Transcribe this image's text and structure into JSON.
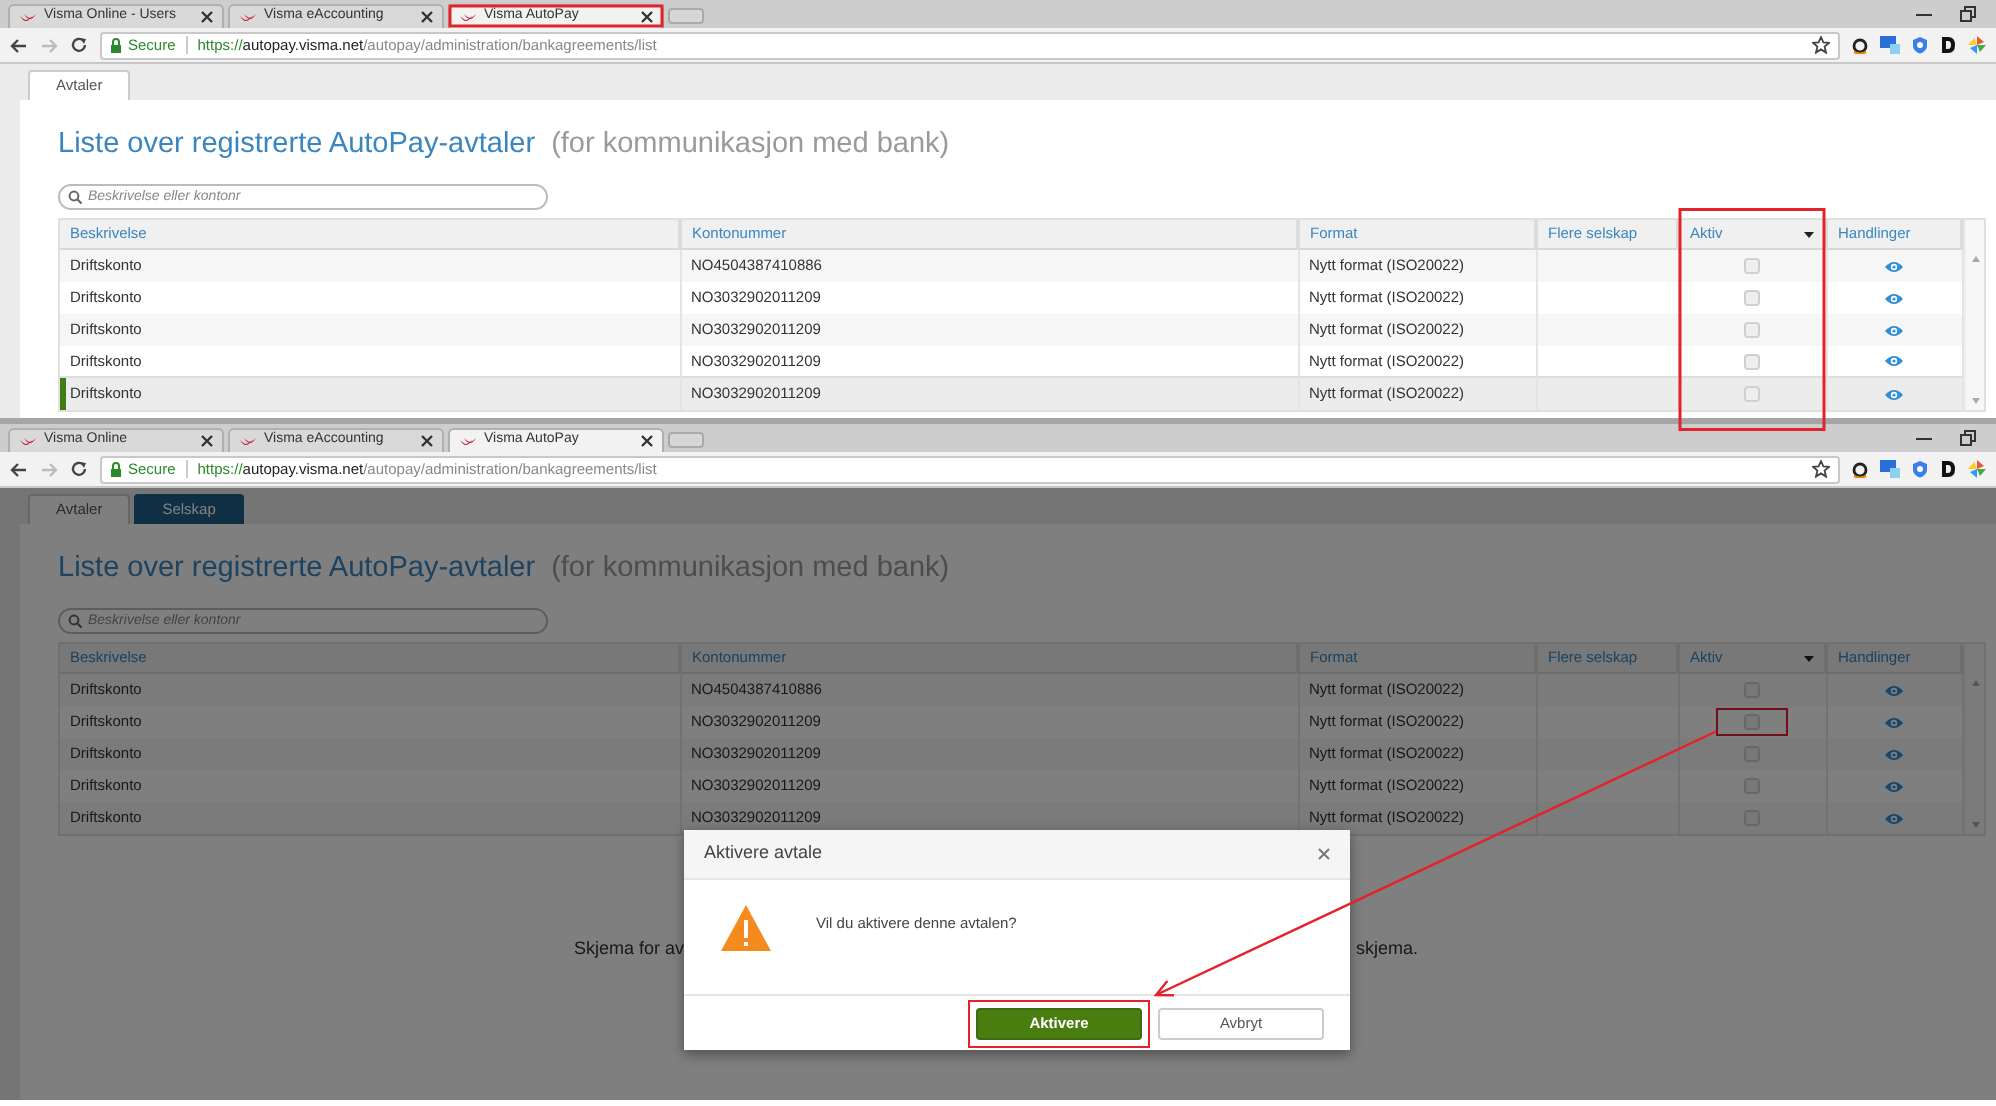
{
  "screens": [
    {
      "browser_tabs": [
        {
          "title": "Visma Online - Users",
          "selected": false,
          "highlighted": false
        },
        {
          "title": "Visma eAccounting",
          "selected": false,
          "highlighted": false
        },
        {
          "title": "Visma AutoPay",
          "selected": true,
          "highlighted": true
        }
      ],
      "address": {
        "secure": "Secure",
        "scheme": "https://",
        "host": "autopay.visma.net",
        "path": "/autopay/administration/bankagreements/list"
      },
      "app_tabs": [
        {
          "label": "Avtaler",
          "selected": true,
          "hovered": false
        }
      ],
      "title": "Liste over registrerte AutoPay-avtaler",
      "subtitle": "(for kommunikasjon med bank)",
      "search": {
        "placeholder": "Beskrivelse eller kontonr"
      },
      "table": {
        "columns": [
          {
            "label": "Beskrivelse",
            "highlighted": false
          },
          {
            "label": "Kontonummer",
            "highlighted": false
          },
          {
            "label": "Format",
            "highlighted": false
          },
          {
            "label": "Flere selskap",
            "highlighted": false
          },
          {
            "label": "Aktiv",
            "highlighted": true
          },
          {
            "label": "Handlinger",
            "highlighted": false
          }
        ],
        "rows": [
          {
            "description": "Driftskonto",
            "account": "NO4504387410886",
            "format": "Nytt format (ISO20022)",
            "active": false,
            "selected": false,
            "checkbox_highlighted": false
          },
          {
            "description": "Driftskonto",
            "account": "NO3032902011209",
            "format": "Nytt format (ISO20022)",
            "active": false,
            "selected": false,
            "checkbox_highlighted": false
          },
          {
            "description": "Driftskonto",
            "account": "NO3032902011209",
            "format": "Nytt format (ISO20022)",
            "active": false,
            "selected": false,
            "checkbox_highlighted": false
          },
          {
            "description": "Driftskonto",
            "account": "NO3032902011209",
            "format": "Nytt format (ISO20022)",
            "active": false,
            "selected": false,
            "checkbox_highlighted": false
          },
          {
            "description": "Driftskonto",
            "account": "NO3032902011209",
            "format": "Nytt format (ISO20022)",
            "active": false,
            "selected": true,
            "checkbox_highlighted": false
          }
        ]
      }
    },
    {
      "browser_tabs": [
        {
          "title": "Visma Online",
          "selected": false,
          "highlighted": false
        },
        {
          "title": "Visma eAccounting",
          "selected": false,
          "highlighted": false
        },
        {
          "title": "Visma AutoPay",
          "selected": true,
          "highlighted": false
        }
      ],
      "address": {
        "secure": "Secure",
        "scheme": "https://",
        "host": "autopay.visma.net",
        "path": "/autopay/administration/bankagreements/list"
      },
      "app_tabs": [
        {
          "label": "Avtaler",
          "selected": true,
          "hovered": false
        },
        {
          "label": "Selskap",
          "selected": false,
          "hovered": true
        }
      ],
      "title": "Liste over registrerte AutoPay-avtaler",
      "subtitle": "(for kommunikasjon med bank)",
      "search": {
        "placeholder": "Beskrivelse eller kontonr"
      },
      "table": {
        "columns": [
          {
            "label": "Beskrivelse",
            "highlighted": false
          },
          {
            "label": "Kontonummer",
            "highlighted": false
          },
          {
            "label": "Format",
            "highlighted": false
          },
          {
            "label": "Flere selskap",
            "highlighted": false
          },
          {
            "label": "Aktiv",
            "highlighted": false
          },
          {
            "label": "Handlinger",
            "highlighted": false
          }
        ],
        "rows": [
          {
            "description": "Driftskonto",
            "account": "NO4504387410886",
            "format": "Nytt format (ISO20022)",
            "active": false,
            "selected": false,
            "checkbox_highlighted": false
          },
          {
            "description": "Driftskonto",
            "account": "NO3032902011209",
            "format": "Nytt format (ISO20022)",
            "active": false,
            "selected": false,
            "checkbox_highlighted": true
          },
          {
            "description": "Driftskonto",
            "account": "NO3032902011209",
            "format": "Nytt format (ISO20022)",
            "active": false,
            "selected": false,
            "checkbox_highlighted": false
          },
          {
            "description": "Driftskonto",
            "account": "NO3032902011209",
            "format": "Nytt format (ISO20022)",
            "active": false,
            "selected": false,
            "checkbox_highlighted": false
          },
          {
            "description": "Driftskonto",
            "account": "NO3032902011209",
            "format": "Nytt format (ISO20022)",
            "active": false,
            "selected": false,
            "checkbox_highlighted": false
          }
        ]
      },
      "background_text_left": "Skjema for av",
      "background_text_right": "skjema.",
      "dialog": {
        "title": "Aktivere avtale",
        "message": "Vil du aktivere denne avtalen?",
        "arrow_from_checkbox": true,
        "buttons": [
          {
            "label": "Aktivere",
            "kind": "primary",
            "highlighted": true
          },
          {
            "label": "Avbryt",
            "kind": "secondary",
            "highlighted": false
          }
        ]
      }
    }
  ]
}
